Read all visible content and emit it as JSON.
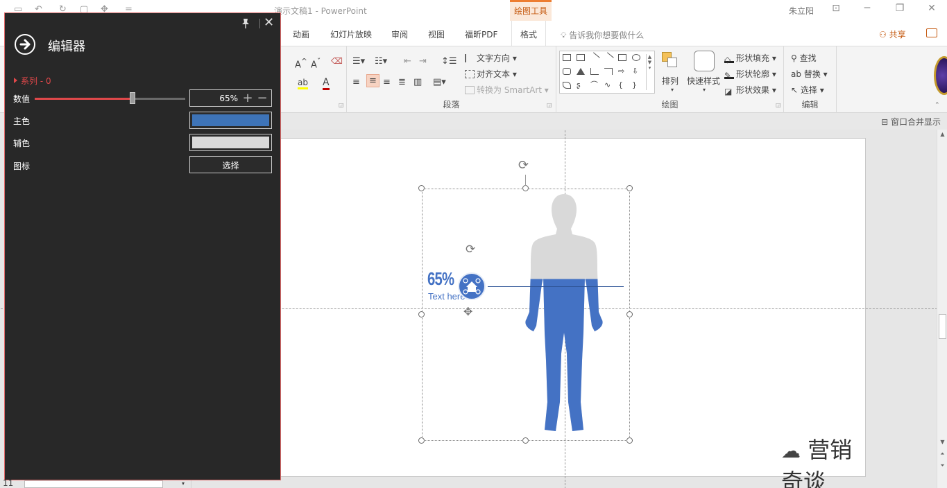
{
  "app": {
    "doc_title": "演示文稿1  -  PowerPoint",
    "contextual_tab": "绘图工具",
    "user": "朱立阳",
    "share": "共享",
    "tell_me": "告诉我你想要做什么"
  },
  "tabs": [
    {
      "label": "动画"
    },
    {
      "label": "幻灯片放映"
    },
    {
      "label": "审阅"
    },
    {
      "label": "视图"
    },
    {
      "label": "福昕PDF"
    },
    {
      "label": "格式"
    }
  ],
  "ribbon": {
    "paragraph": {
      "label": "段落",
      "text_direction": "文字方向",
      "align_text": "对齐文本",
      "smartart": "转换为 SmartArt"
    },
    "drawing": {
      "label": "绘图",
      "arrange": "排列",
      "quick_styles": "快速样式",
      "shape_fill": "形状填充",
      "shape_outline": "形状轮廓",
      "shape_effects": "形状效果"
    },
    "editing": {
      "label": "编辑",
      "find": "查找",
      "replace": "替换",
      "select": "选择"
    }
  },
  "status": {
    "merge_display": "窗口合并显示"
  },
  "editor": {
    "title": "编辑器",
    "series": "系列 - 0",
    "value_label": "数值",
    "value": "65%",
    "value_fraction": 0.65,
    "primary_color_label": "主色",
    "primary_color": "#3e74b8",
    "secondary_color_label": "辅色",
    "secondary_color": "#d9d9d9",
    "icon_label": "图标",
    "select_button": "选择"
  },
  "slide": {
    "percent_text": "65%",
    "caption": "Text here",
    "figure_fill_color": "#4472c4",
    "figure_empty_color": "#d9d9d9",
    "fill_fraction": 0.65
  },
  "watermark": "营销奇谈"
}
